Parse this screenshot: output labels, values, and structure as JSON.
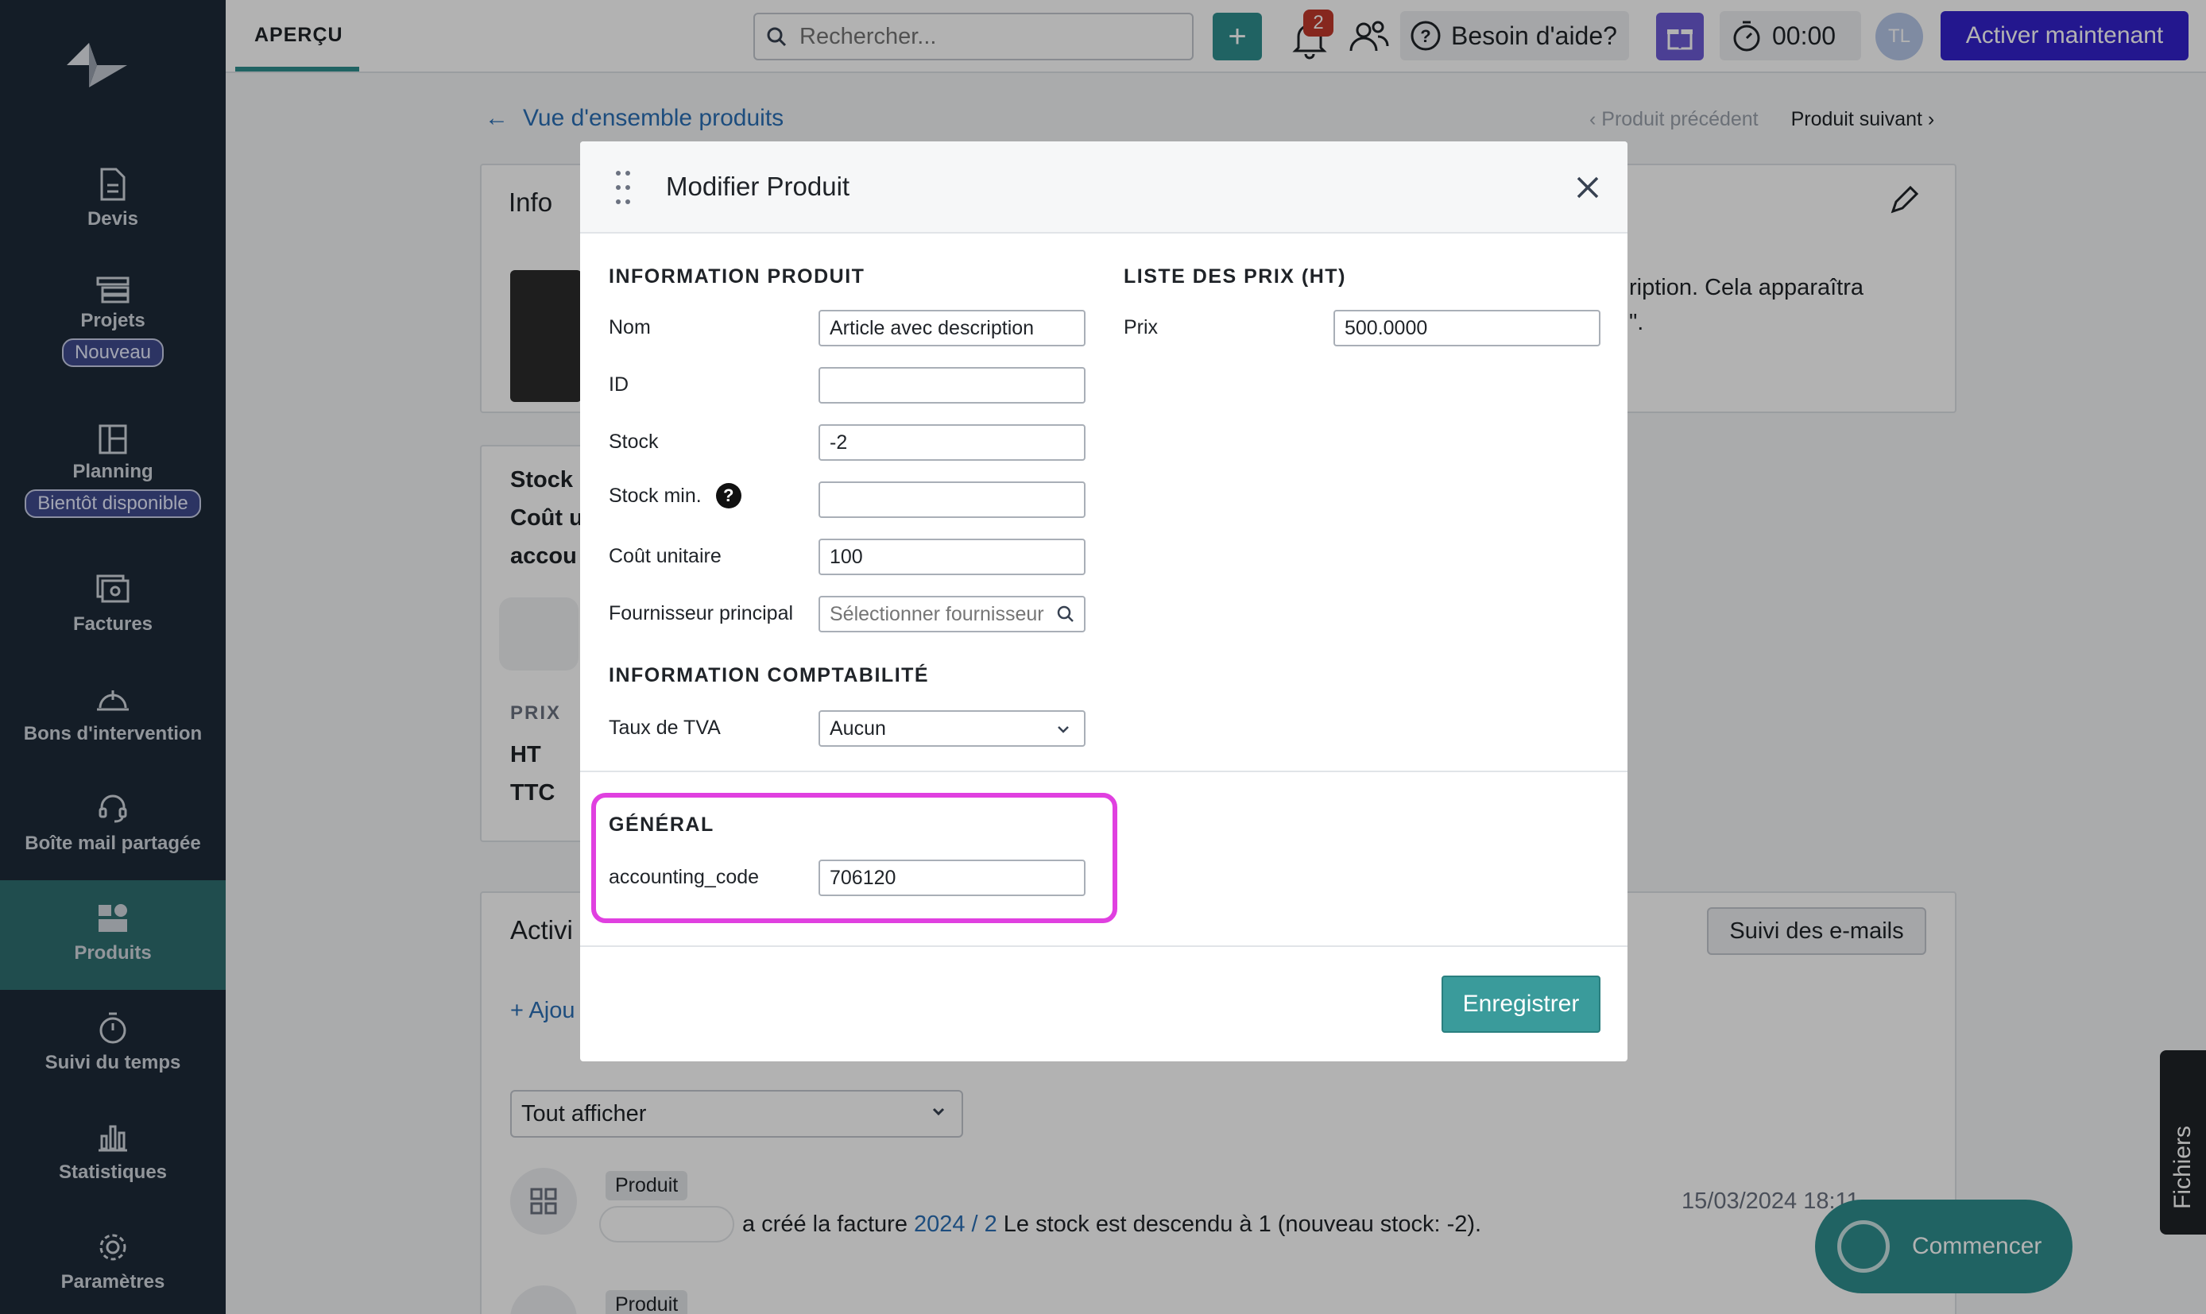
{
  "sidebar": {
    "items": [
      {
        "label": "Devis",
        "icon": "document-icon"
      },
      {
        "label": "Projets",
        "icon": "projects-icon",
        "badge": "Nouveau"
      },
      {
        "label": "Planning",
        "icon": "planning-icon",
        "badge": "Bientôt disponible"
      },
      {
        "label": "Factures",
        "icon": "invoice-icon"
      },
      {
        "label": "Bons d'intervention",
        "icon": "helmet-icon"
      },
      {
        "label": "Boîte mail partagée",
        "icon": "headset-icon"
      },
      {
        "label": "Produits",
        "icon": "products-icon",
        "active": true
      },
      {
        "label": "Suivi du temps",
        "icon": "stopwatch-icon"
      },
      {
        "label": "Statistiques",
        "icon": "bar-chart-icon"
      },
      {
        "label": "Paramètres",
        "icon": "gear-icon"
      }
    ]
  },
  "topbar": {
    "tab": "APERÇU",
    "search_placeholder": "Rechercher...",
    "notifications_count": "2",
    "help_label": "Besoin d'aide?",
    "timer": "00:00",
    "avatar_initials": "TL",
    "activate_label": "Activer maintenant"
  },
  "page": {
    "back_link": "Vue d'ensemble produits",
    "prev_label": "Produit précédent",
    "next_label": "Produit suivant",
    "info_title": "Info",
    "desc_line1": "ription. Cela apparaîtra",
    "desc_line2": "\".",
    "stock_label": "Stock",
    "cout_label": "Coût u",
    "accou_label": "accou",
    "prix_label": "PRIX",
    "ht_label": "HT",
    "ttc_label": "TTC",
    "activity_title": "Activi",
    "emails_button": "Suivi des e-mails",
    "add_label": "Ajou",
    "filter_value": "Tout afficher",
    "activity_tag": "Produit",
    "activity_text_pre": "a créé la facture",
    "activity_link": "2024 / 2",
    "activity_text_post": "Le stock est descendu à 1 (nouveau stock: -2).",
    "activity_date": "15/03/2024 18:11",
    "activity_tag2": "Produit",
    "files_label": "Fichiers",
    "start_label": "Commencer"
  },
  "modal": {
    "title": "Modifier Produit",
    "product_section": "INFORMATION PRODUIT",
    "price_section": "LISTE DES PRIX (HT)",
    "fields": {
      "nom_label": "Nom",
      "nom_value": "Article avec description",
      "id_label": "ID",
      "id_value": "",
      "stock_label": "Stock",
      "stock_value": "-2",
      "stock_min_label": "Stock min.",
      "stock_min_value": "",
      "cout_label": "Coût unitaire",
      "cout_value": "100",
      "fournisseur_label": "Fournisseur principal",
      "fournisseur_placeholder": "Sélectionner fournisseur",
      "prix_label": "Prix",
      "prix_value": "500.0000"
    },
    "accounting_section": "INFORMATION COMPTABILITÉ",
    "tva_label": "Taux de TVA",
    "tva_value": "Aucun",
    "general_section": "GÉNÉRAL",
    "accounting_code_label": "accounting_code",
    "accounting_code_value": "706120",
    "save_label": "Enregistrer"
  },
  "colors": {
    "sidebar_bg": "#1e2a38",
    "accent_teal": "#2f8f8f",
    "activate_bg": "#3322cc",
    "highlight": "#e040e0"
  }
}
